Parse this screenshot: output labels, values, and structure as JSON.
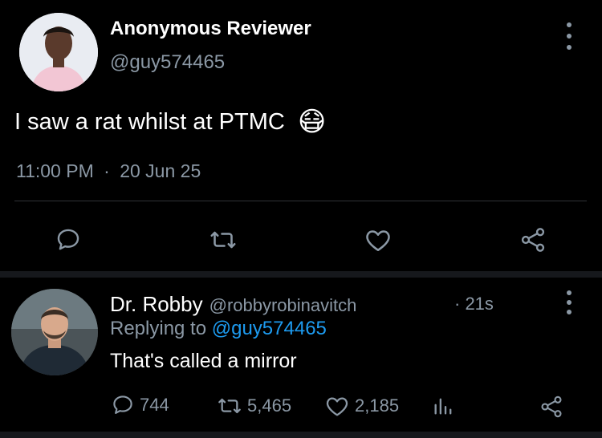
{
  "tweet": {
    "author_name": "Anonymous Reviewer",
    "author_handle": "@guy574465",
    "text": "I saw a rat whilst at PTMC",
    "emoji": "😷",
    "time": "11:00 PM",
    "separator": "·",
    "date": "20 Jun 25"
  },
  "reply": {
    "author_name": "Dr. Robby",
    "author_handle": "@robbyrobinavitch",
    "age": "· 21s",
    "replying_prefix": "Replying to",
    "replying_handle": "@guy574465",
    "text": "That's called a mirror",
    "reply_count": "744",
    "retweet_count": "5,465",
    "like_count": "2,185"
  },
  "colors": {
    "background": "#000000",
    "muted": "#8b98a5",
    "link": "#1d9bf0",
    "divider": "#2f3336"
  },
  "icons": [
    "more-icon",
    "reply-icon",
    "retweet-icon",
    "like-icon",
    "share-icon",
    "analytics-icon"
  ]
}
